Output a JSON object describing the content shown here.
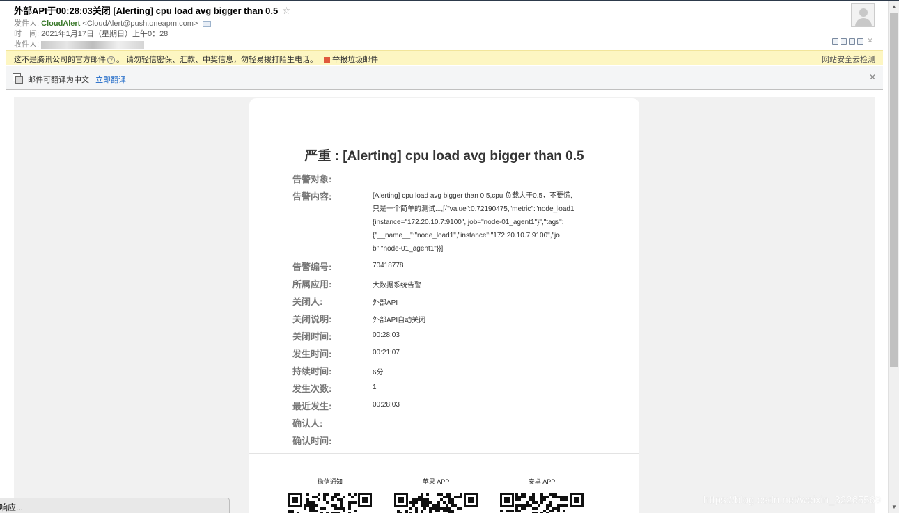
{
  "header": {
    "subject": "外部API于00:28:03关闭 [Alerting] cpu load avg bigger than 0.5",
    "star_icon": "star-outline-icon",
    "from_label": "发件人:",
    "from_name": "CloudAlert",
    "from_address": "<CloudAlert@push.oneapm.com>",
    "time_label": "时　间:",
    "time_value": "2021年1月17日（星期日）上午0：28",
    "to_label": "收件人:"
  },
  "warning": {
    "text": "这不是腾讯公司的官方邮件",
    "text2": "。 请勿轻信密保、汇款、中奖信息，勿轻易拨打陌生电话。",
    "report": "举报垃圾邮件",
    "right": "网站安全云检测"
  },
  "translate": {
    "text": "邮件可翻译为中文",
    "link": "立即翻译"
  },
  "alert": {
    "title": "严重 : [Alerting] cpu load avg bigger than 0.5",
    "fields": {
      "target_label": "告警对象:",
      "content_label": "告警内容:",
      "id_label": "告警编号:",
      "app_label": "所属应用:",
      "closer_label": "关闭人:",
      "close_note_label": "关闭说明:",
      "close_time_label": "关闭时间:",
      "occur_time_label": "发生时间:",
      "duration_label": "持续时间:",
      "count_label": "发生次数:",
      "recent_label": "最近发生:",
      "confirmer_label": "确认人:",
      "confirm_time_label": "确认时间:"
    },
    "content_lines": [
      "[Alerting] cpu load avg bigger than 0.5,cpu 负载大于0.5，不要慌,",
      "只是一个简单的测试...,[{\"value\":0.72190475,\"metric\":\"node_load1",
      "{instance=\"172.20.10.7:9100\", job=\"node-01_agent1\"}\",\"tags\":",
      "{\"__name__\":\"node_load1\",\"instance\":\"172.20.10.7:9100\",\"jo",
      "b\":\"node-01_agent1\"}}]"
    ],
    "id": "70418778",
    "app": "大数据系统告警",
    "closer": "外部API",
    "close_note": "外部API自动关闭",
    "close_time": "00:28:03",
    "occur_time": "00:21:07",
    "duration": "6分",
    "count": "1",
    "recent": "00:28:03"
  },
  "qr": {
    "wechat": "微信通知",
    "apple": "苹果 APP",
    "android": "安卓 APP"
  },
  "status_text": "响应...",
  "watermark": "https://blog.csdn.net/weixin_32265569"
}
